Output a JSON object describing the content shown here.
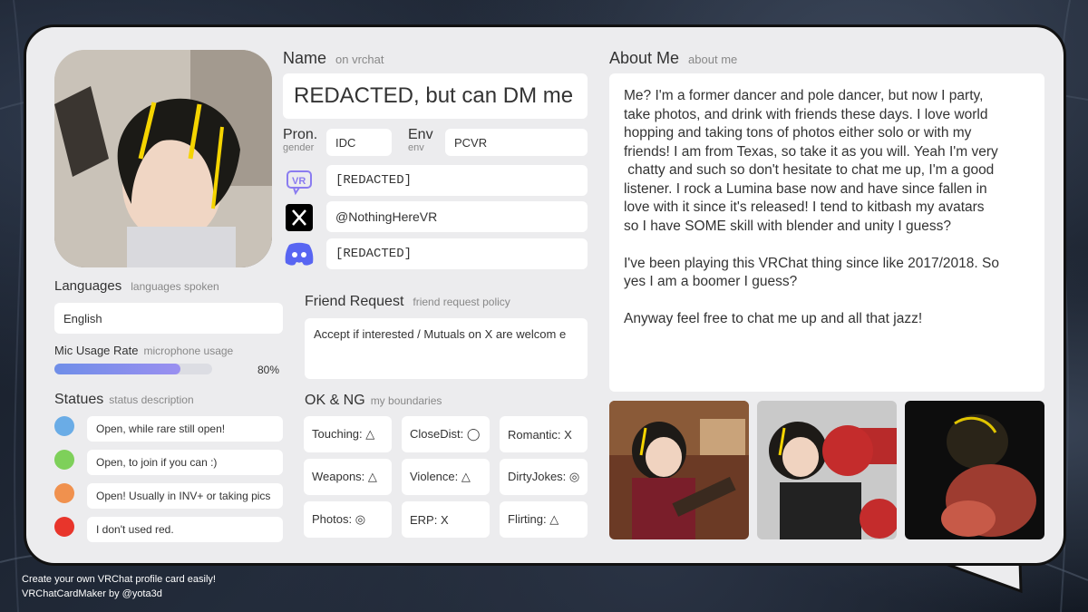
{
  "name": {
    "title": "Name",
    "subtitle": "on vrchat",
    "value": "REDACTED, but can DM me"
  },
  "pronouns": {
    "title": "Pron.",
    "subtitle": "gender",
    "value": "IDC"
  },
  "env": {
    "title": "Env",
    "subtitle": "env",
    "value": "PCVR"
  },
  "socials": [
    {
      "icon": "vrchat-icon",
      "value": "[REDACTED]"
    },
    {
      "icon": "x-twitter-icon",
      "value": "@NothingHereVR"
    },
    {
      "icon": "discord-icon",
      "value": "[REDACTED]"
    }
  ],
  "languages": {
    "title": "Languages",
    "subtitle": "languages spoken",
    "value": "English"
  },
  "mic": {
    "title": "Mic Usage Rate",
    "subtitle": "microphone usage",
    "percent_label": "80%",
    "percent": 80
  },
  "statuses": {
    "title": "Statues",
    "subtitle": "status description",
    "items": [
      {
        "color": "#6aace6",
        "text": "Open, while rare still open!"
      },
      {
        "color": "#7ed05a",
        "text": "Open, to join if you can :)"
      },
      {
        "color": "#f0914e",
        "text": "Open! Usually in INV+ or taking pics"
      },
      {
        "color": "#e8352b",
        "text": "I don't used red."
      }
    ]
  },
  "friend_request": {
    "title": "Friend Request",
    "subtitle": "friend request policy",
    "value": "Accept if interested / Mutuals on X are welcom e"
  },
  "boundaries": {
    "title": "OK & NG",
    "subtitle": "my boundaries",
    "items": [
      "Touching: △",
      "CloseDist: ◯",
      "Romantic: X",
      "Weapons: △",
      "Violence: △",
      "DirtyJokes: ◎",
      "Photos: ◎",
      "ERP: X",
      "Flirting: △"
    ]
  },
  "about": {
    "title": "About Me",
    "subtitle": "about me",
    "lines": [
      "Me? I'm a former dancer and pole dancer, but now I party,",
      "take photos, and drink with friends these days. I love world",
      "hopping and taking tons of photos either solo or with my",
      "friends! I am from Texas, so take it as you will. Yeah I'm very",
      " chatty and such so don't hesitate to chat me up, I'm a good",
      "listener. I rock a Lumina base now and have since fallen in",
      "love with it since it's released! I tend to kitbash my avatars",
      "so I have SOME skill with blender and unity I guess?",
      "",
      "I've been playing this VRChat thing since like 2017/2018. So",
      "yes I am a boomer I guess?",
      "",
      "Anyway feel free to chat me up and all that jazz!"
    ]
  },
  "footer": {
    "line1": "Create your own VRChat profile card easily!",
    "line2": "VRChatCardMaker by @yota3d"
  }
}
